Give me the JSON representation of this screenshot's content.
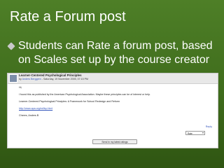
{
  "slide": {
    "title": "Rate a Forum post",
    "bullet": "Students can Rate a forum post, based on Scales set up by the course creator"
  },
  "post": {
    "title": "Learner-Centered Psychological Principles",
    "meta_prefix": "by",
    "author": "Anders Berggren",
    "meta_date": "- Saturday, 19 November 2005, 07:15 PM",
    "body_lines": [
      "Hi,",
      "I found this as published by the American Psychological Association. Maybe these principles can be of interest or help.",
      "Learner-Centered Psychological Principles: A Framework for School Redesign and Reform",
      "http://www.apa.org/ed/lcp.html",
      "Cheers, Anders B"
    ],
    "reply_label": "Reply",
    "rate_select_value": "Rate",
    "send_button_label": "Send in my latest ratings"
  },
  "colors": {
    "slide_bg": "#3f6c1c",
    "slide_text": "#ffffff",
    "link": "#3355bb",
    "header_bg": "#e8e8e8"
  }
}
